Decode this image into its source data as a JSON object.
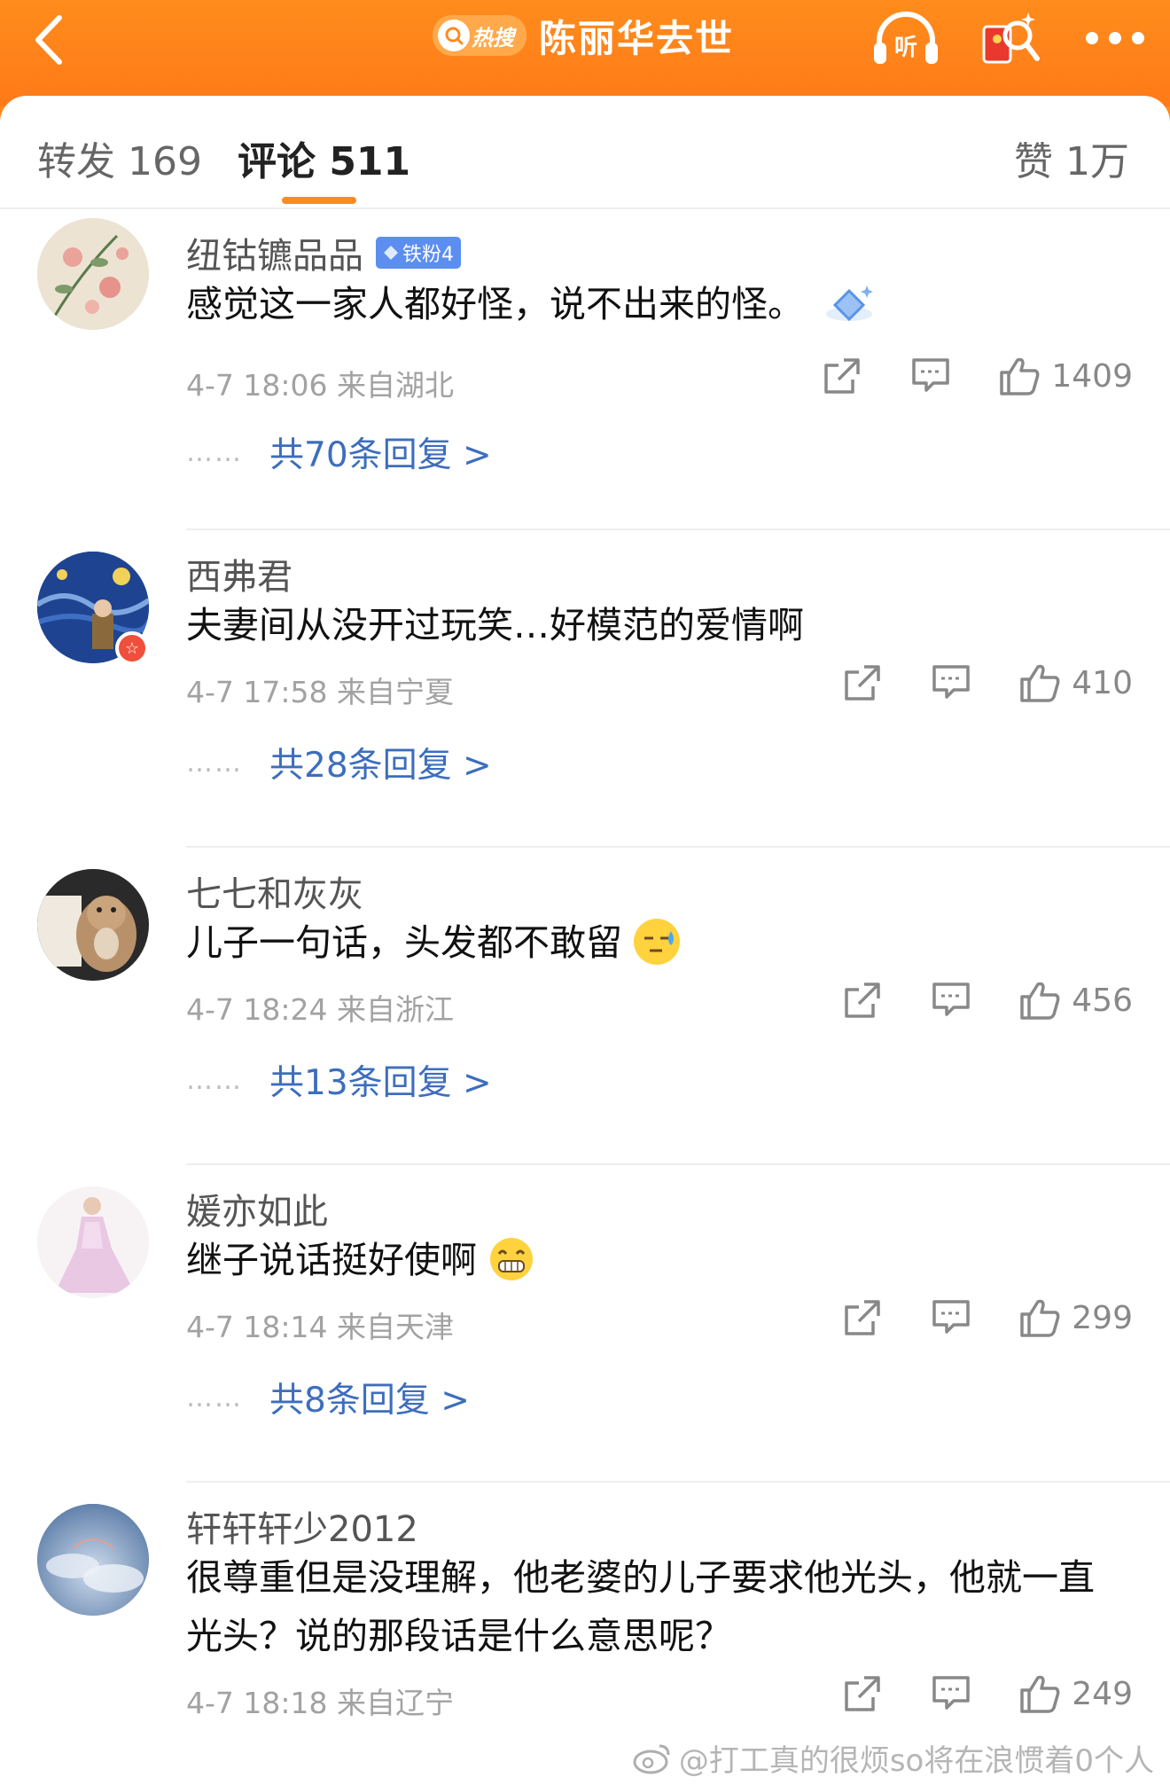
{
  "header": {
    "hot_label": "热搜",
    "title": "陈丽华去世",
    "listen_label": "听"
  },
  "tabs": [
    {
      "label": "转发 169"
    },
    {
      "label": "评论 511"
    }
  ],
  "likes_tab": "赞 1万",
  "colors": {
    "accent": "#ff8a1f",
    "link": "#3d6ebd",
    "meta": "#a2a2a2"
  },
  "comments": [
    {
      "name": "纽钴镳品品",
      "badge": "铁粉4",
      "text": "感觉这一家人都好怪，说不出来的怪。",
      "meta": "4-7 18:06  来自湖北",
      "likes": "1409",
      "replies": "共70条回复 >"
    },
    {
      "name": "西弗君",
      "text": "夫妻间从没开过玩笑…好模范的爱情啊",
      "meta": "4-7 17:58  来自宁夏",
      "likes": "410",
      "replies": "共28条回复 >"
    },
    {
      "name": "七七和灰灰",
      "text": "儿子一句话，头发都不敢留",
      "emoji": "sweat-face-emoji",
      "meta": "4-7 18:24  来自浙江",
      "likes": "456",
      "replies": "共13条回复 >"
    },
    {
      "name": "媛亦如此",
      "text": "继子说话挺好使啊",
      "emoji": "grin-face-emoji",
      "meta": "4-7 18:14  来自天津",
      "likes": "299",
      "replies": "共8条回复 >"
    },
    {
      "name": "轩轩轩少2012",
      "text": "很尊重但是没理解，他老婆的儿子要求他光头，他就一直光头？说的那段话是什么意思呢？",
      "meta": "4-7 18:18  来自辽宁",
      "likes": "249"
    }
  ],
  "watermark": "@打工真的很烦so将在浪惯着0个人"
}
